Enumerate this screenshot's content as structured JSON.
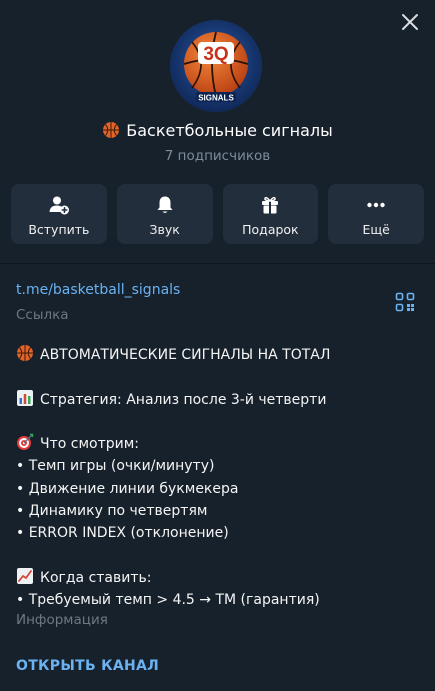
{
  "channel": {
    "title": "Баскетбольные сигналы",
    "title_emoji": "basketball-emoji",
    "subscribers": "7 подписчиков",
    "avatar": {
      "main_text": "3Q",
      "sub_text": "SIGNALS"
    }
  },
  "actions": [
    {
      "label": "Вступить",
      "icon": "add-user-icon"
    },
    {
      "label": "Звук",
      "icon": "bell-icon"
    },
    {
      "label": "Подарок",
      "icon": "gift-icon"
    },
    {
      "label": "Ещё",
      "icon": "more-icon"
    }
  ],
  "info": {
    "link": "t.me/basketball_signals",
    "link_caption": "Ссылка",
    "description_lines": [
      "АВТОМАТИЧЕСКИЕ СИГНАЛЫ НА ТОТАЛ",
      "",
      "Стратегия: Анализ после 3-й четверти",
      "",
      "Что смотрим:",
      "• Темп игры (очки/минуту)",
      "• Движение линии букмекера",
      "• Динамику по четвертям",
      "• ERROR INDEX (отклонение)",
      "",
      "Когда ставить:",
      "• Требуемый темп > 4.5 → ТМ (гарантия)"
    ],
    "description_caption": "Информация",
    "open_channel": "ОТКРЫТЬ КАНАЛ"
  },
  "colors": {
    "background": "#17212b",
    "button_bg": "#232e3c",
    "link": "#6ab2f2",
    "muted": "#6d7883",
    "basketball": "#e0642a"
  }
}
